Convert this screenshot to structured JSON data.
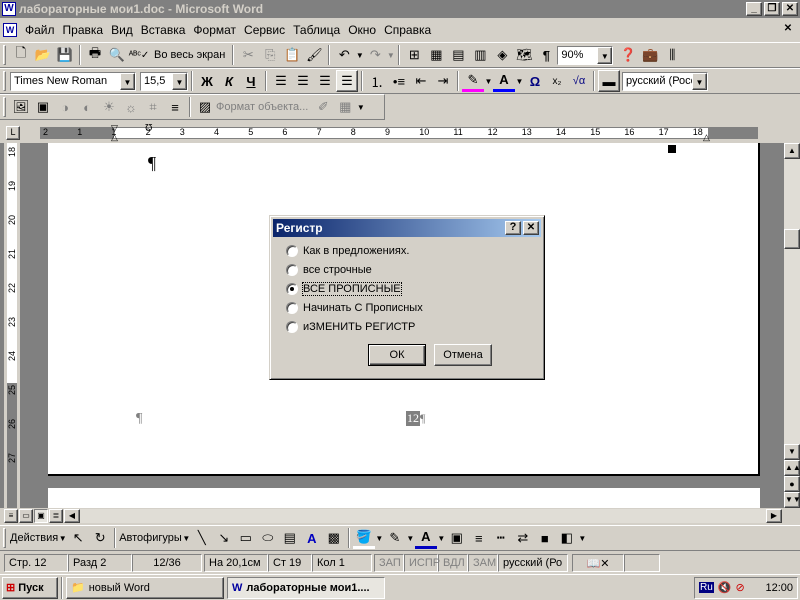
{
  "window": {
    "title": "лабораторные мои1.doc - Microsoft Word",
    "app_icon": "W"
  },
  "menu": [
    "Файл",
    "Правка",
    "Вид",
    "Вставка",
    "Формат",
    "Сервис",
    "Таблица",
    "Окно",
    "Справка"
  ],
  "standard_toolbar": {
    "view_label": "Во весь экран",
    "zoom": "90%"
  },
  "format_toolbar": {
    "font": "Times New Roman",
    "size": "15,5",
    "bold": "Ж",
    "italic": "К",
    "underline": "Ч",
    "language": "русский (Росс"
  },
  "picture_toolbar": {
    "format_object": "Формат объекта..."
  },
  "ruler": {
    "labels": [
      "2",
      "1",
      "1",
      "2",
      "3",
      "4",
      "5",
      "6",
      "7",
      "8",
      "9",
      "10",
      "11",
      "12",
      "13",
      "14",
      "15",
      "16",
      "17",
      "18"
    ]
  },
  "vruler": {
    "labels": [
      "18",
      "19",
      "20",
      "21",
      "22",
      "23",
      "24",
      "25",
      "26",
      "27"
    ]
  },
  "document": {
    "pilcrow": "¶",
    "page_number": "12",
    "footer_pilcrow": "¶"
  },
  "dialog": {
    "title": "Регистр",
    "help": "?",
    "options": [
      {
        "label": "Как в предложениях.",
        "checked": false
      },
      {
        "label": "все строчные",
        "checked": false
      },
      {
        "label": "ВСЕ ПРОПИСНЫЕ",
        "checked": true
      },
      {
        "label": "Начинать С Прописных",
        "checked": false
      },
      {
        "label": "иЗМЕНИТЬ РЕГИСТР",
        "checked": false
      }
    ],
    "ok": "ОК",
    "cancel": "Отмена"
  },
  "drawing_toolbar": {
    "actions": "Действия",
    "autoshapes": "Автофигуры"
  },
  "status": {
    "page": "Стр. 12",
    "section": "Разд 2",
    "pages": "12/36",
    "at": "На 20,1см",
    "line": "Ст 19",
    "col": "Кол 1",
    "rec": "ЗАП",
    "trk": "ИСПР",
    "ext": "ВДЛ",
    "ovr": "ЗАМ",
    "lang": "русский (Ро"
  },
  "taskbar": {
    "start": "Пуск",
    "task1": "новый Word",
    "task2": "лабораторные мои1....",
    "lang": "Ru",
    "clock": "12:00"
  },
  "colors": {
    "titlebar_inactive": "#808080",
    "dialog_title_start": "#0a246a",
    "dialog_title_end": "#a6caf0"
  }
}
